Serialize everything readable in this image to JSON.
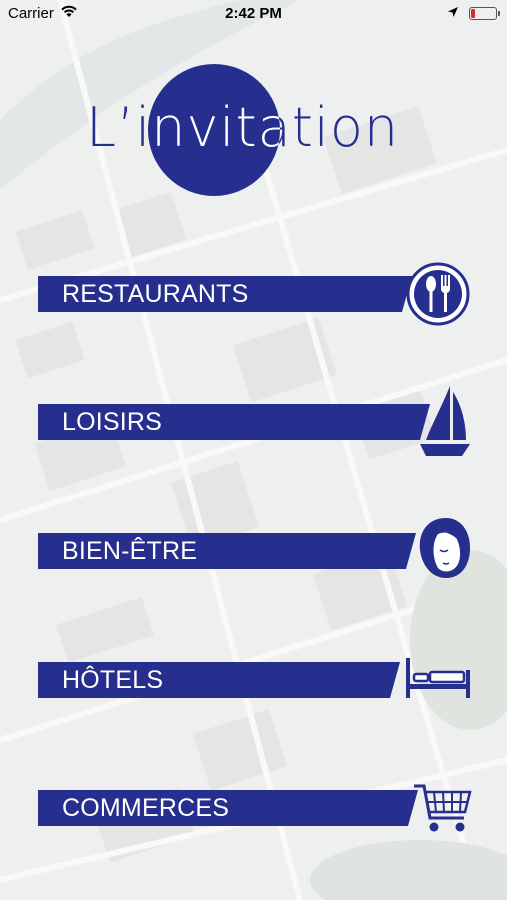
{
  "status_bar": {
    "carrier": "Carrier",
    "time": "2:42 PM",
    "battery_level": 0.15
  },
  "logo": {
    "text": "L’invitation"
  },
  "menu": {
    "items": [
      {
        "label": "RESTAURANTS",
        "icon": "fork-spoon-icon"
      },
      {
        "label": "LOISIRS",
        "icon": "sailboat-icon"
      },
      {
        "label": "BIEN-ÊTRE",
        "icon": "woman-face-icon"
      },
      {
        "label": "HÔTELS",
        "icon": "bed-icon"
      },
      {
        "label": "COMMERCES",
        "icon": "shopping-cart-icon"
      }
    ]
  },
  "colors": {
    "brand": "#262e8e",
    "battery_low": "#e02b2b",
    "background": "#f1f2f1"
  }
}
